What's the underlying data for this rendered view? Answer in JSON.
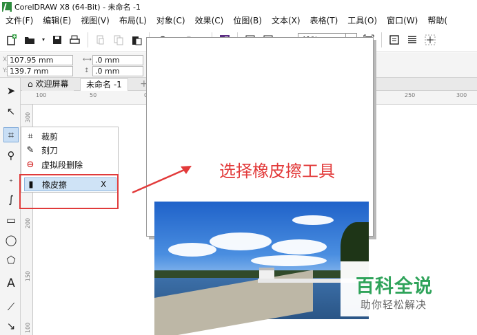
{
  "window": {
    "title": "CorelDRAW X8 (64-Bit) - 未命名 -1"
  },
  "menubar": {
    "items": [
      "文件(F)",
      "编辑(E)",
      "视图(V)",
      "布局(L)",
      "对象(C)",
      "效果(C)",
      "位图(B)",
      "文本(X)",
      "表格(T)",
      "工具(O)",
      "窗口(W)",
      "帮助("
    ]
  },
  "toolbar": {
    "zoom_value": "41%",
    "icons": [
      "new-document",
      "open-folder",
      "save",
      "print",
      "cut",
      "copy",
      "paste",
      "undo",
      "redo",
      "corel-connect",
      "import",
      "export",
      "publish-pdf",
      "zoom-level",
      "full-screen",
      "options",
      "align",
      "guides"
    ]
  },
  "property_bar": {
    "x_value": "107.95 mm",
    "y_value": "139.7 mm",
    "x_label": "X:",
    "y_label": "Y:",
    "width_value": ".0 mm",
    "height_value": ".0 mm",
    "angle_value": ".0",
    "degree_symbol": "°"
  },
  "tabs": [
    {
      "label": "欢迎屏幕"
    },
    {
      "label": "未命名 -1"
    }
  ],
  "tab_add_label": "+",
  "ruler_h_ticks": [
    "100",
    "50",
    "0",
    "50",
    "100",
    "150",
    "200",
    "250",
    "300"
  ],
  "ruler_v_ticks": [
    "300",
    "250",
    "200",
    "150",
    "100"
  ],
  "flyout": {
    "items": [
      {
        "label": "裁剪",
        "icon": "crop-icon"
      },
      {
        "label": "刻刀",
        "icon": "knife-icon"
      },
      {
        "label": "虚拟段删除",
        "icon": "virtual-segment-delete-icon"
      },
      {
        "label": "橡皮擦",
        "icon": "eraser-icon",
        "shortcut": "X",
        "selected": true
      }
    ]
  },
  "annotation": {
    "text": "选择橡皮擦工具",
    "color": "#e23a3a"
  },
  "watermark": {
    "title": "百科全说",
    "subtitle": "助你轻松解决",
    "color": "#2fa35a"
  }
}
